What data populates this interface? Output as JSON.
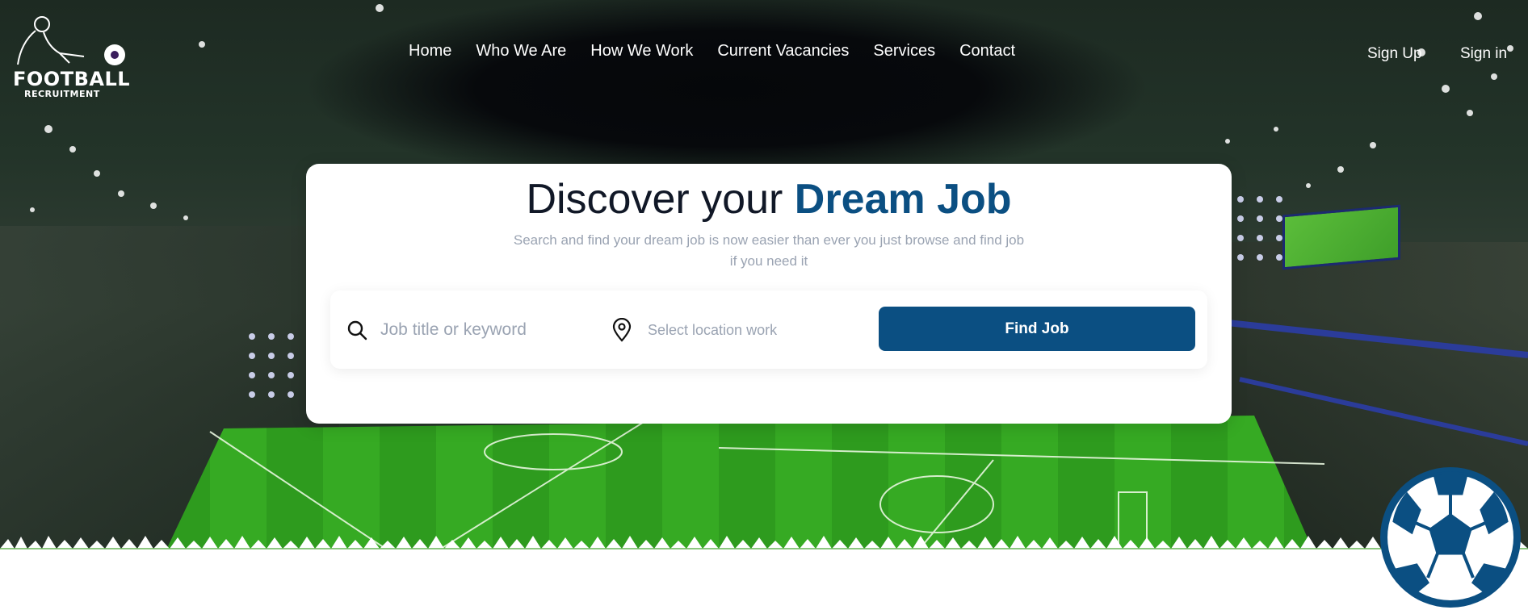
{
  "brand": {
    "line1": "FOOTBALL",
    "line2": "RECRUITMENT"
  },
  "nav": [
    "Home",
    "Who We Are",
    "How We Work",
    "Current Vacancies",
    "Services",
    "Contact"
  ],
  "auth": {
    "signup": "Sign Up",
    "signin": "Sign in"
  },
  "hero": {
    "title_plain": "Discover your",
    "title_accent": "Dream Job",
    "subtitle": "Search and find your dream job is now easier than ever you just browse and find job if you need it"
  },
  "search": {
    "keyword_placeholder": "Job title or keyword",
    "location_placeholder": "Select location work",
    "button_label": "Find Job"
  },
  "colors": {
    "accent": "#0b4f82",
    "muted": "#9aa3b2",
    "dots": "#c9cde8"
  },
  "icons": [
    "search-icon",
    "location-pin-icon",
    "soccer-ball-icon"
  ]
}
